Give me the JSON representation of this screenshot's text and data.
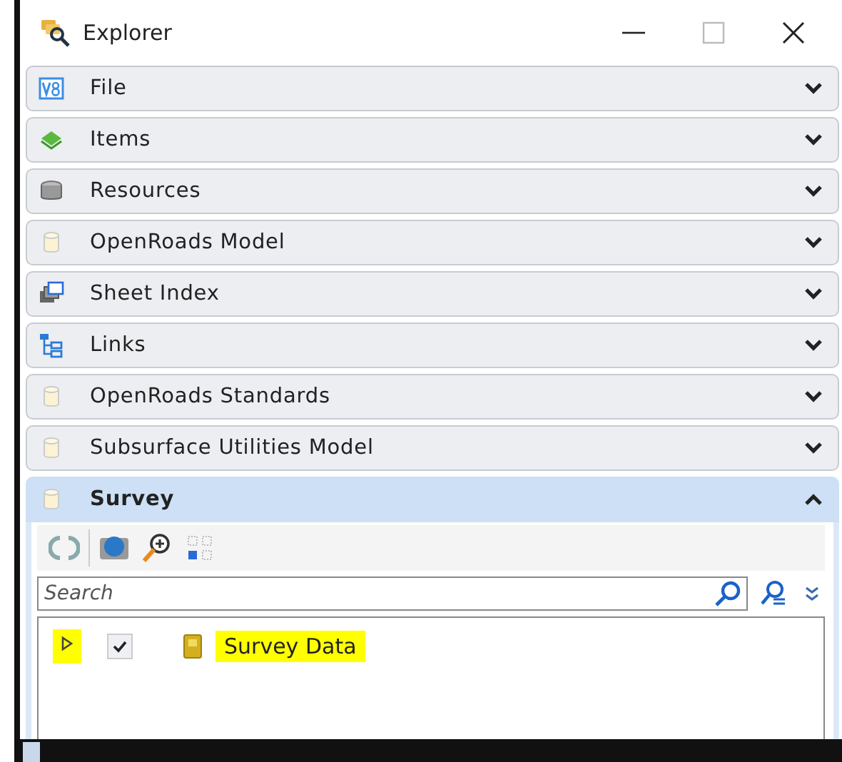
{
  "window": {
    "title": "Explorer"
  },
  "sections": [
    {
      "label": "File",
      "kind": "file",
      "expanded": false
    },
    {
      "label": "Items",
      "kind": "items",
      "expanded": false
    },
    {
      "label": "Resources",
      "kind": "resources",
      "expanded": false
    },
    {
      "label": "OpenRoads Model",
      "kind": "model",
      "expanded": false
    },
    {
      "label": "Sheet Index",
      "kind": "sheets",
      "expanded": false
    },
    {
      "label": "Links",
      "kind": "links",
      "expanded": false
    },
    {
      "label": "OpenRoads Standards",
      "kind": "model",
      "expanded": false
    },
    {
      "label": "Subsurface Utilities Model",
      "kind": "model",
      "expanded": false
    },
    {
      "label": "Survey",
      "kind": "model",
      "expanded": true
    }
  ],
  "search": {
    "placeholder": "Search"
  },
  "tree": [
    {
      "label": "Survey Data",
      "checked": true,
      "expanded": false,
      "highlighted": true
    }
  ]
}
